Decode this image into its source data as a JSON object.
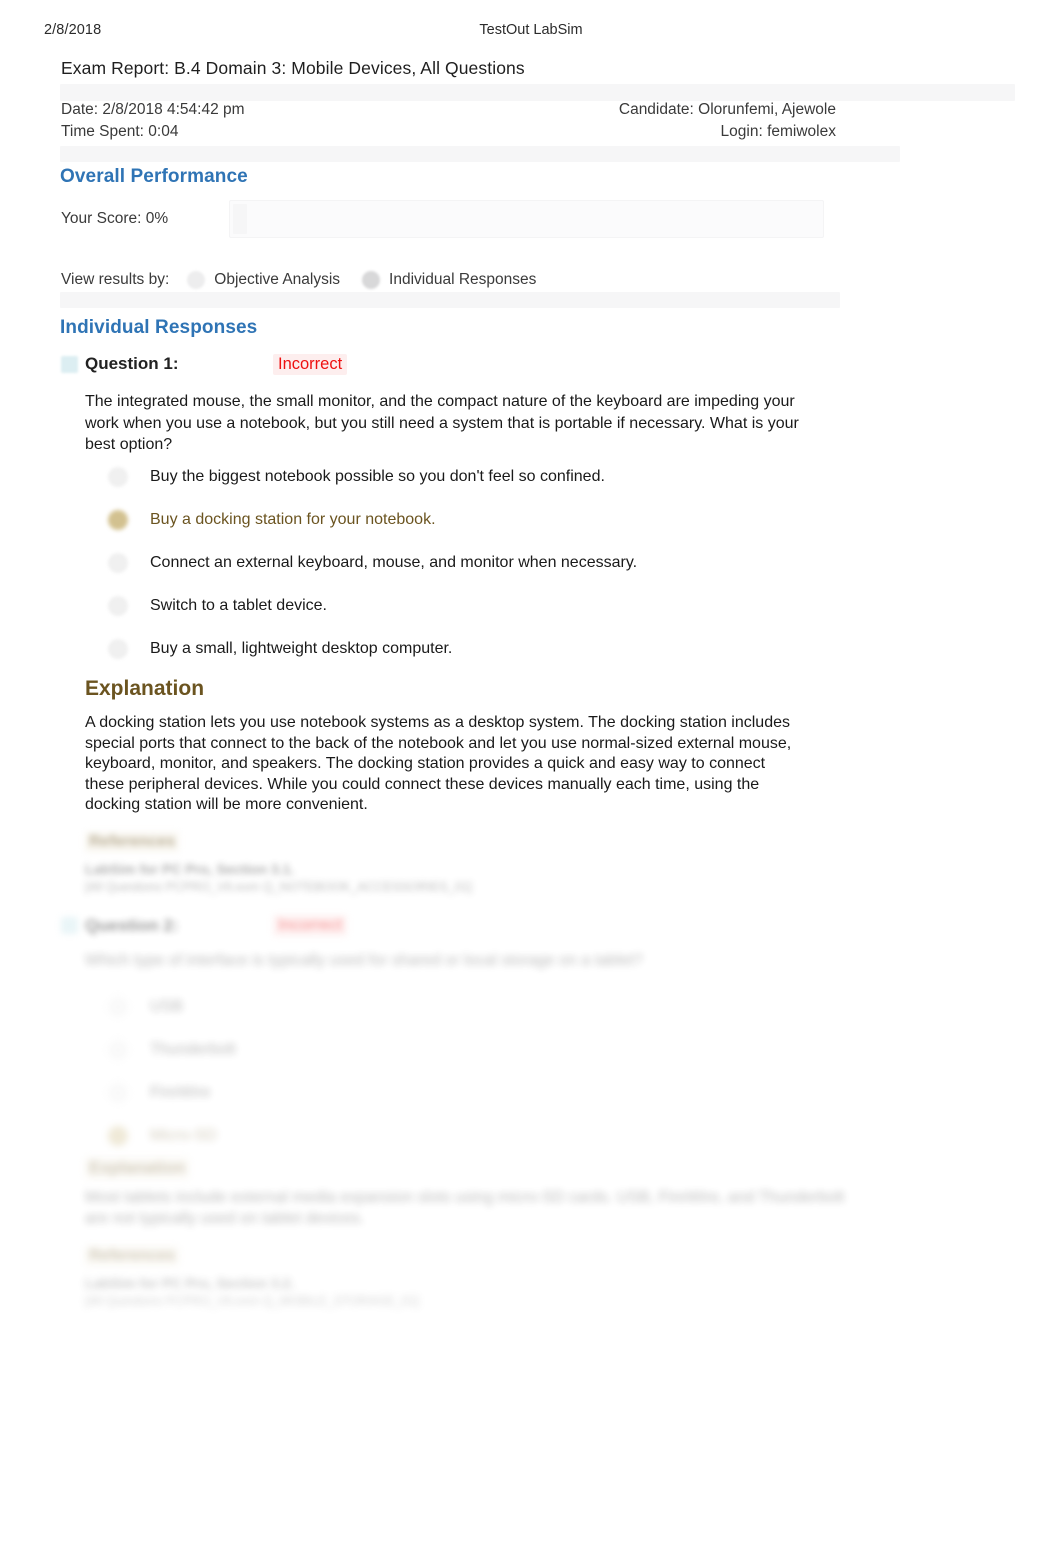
{
  "header": {
    "date": "2/8/2018",
    "app_title": "TestOut LabSim"
  },
  "report": {
    "title": "Exam Report: B.4 Domain 3: Mobile Devices, All Questions",
    "date_label": "Date: 2/8/2018 4:54:42 pm",
    "time_spent_label": "Time Spent: 0:04",
    "candidate_label": "Candidate: Olorunfemi, Ajewole",
    "login_label": "Login: femiwolex"
  },
  "overall": {
    "heading": "Overall Performance",
    "score_label": "Your Score: 0%",
    "score_percent": 0
  },
  "view_by": {
    "label": "View results by:",
    "options": [
      {
        "label": "Objective Analysis",
        "selected": false
      },
      {
        "label": "Individual Responses",
        "selected": true
      }
    ]
  },
  "individual_responses": {
    "heading": "Individual Responses",
    "questions": [
      {
        "label": "Question 1:",
        "status": "Incorrect",
        "text": "The integrated mouse, the small monitor, and the compact nature of the keyboard are impeding your work when you use a notebook, but you still need a system that is portable if necessary. What is your best option?",
        "options": [
          {
            "text": "Buy the biggest notebook possible so you don't feel so confined.",
            "correct": false
          },
          {
            "text": "Buy a docking station for your notebook.",
            "correct": true
          },
          {
            "text": "Connect an external keyboard, mouse, and monitor when necessary.",
            "correct": false
          },
          {
            "text": "Switch to a tablet device.",
            "correct": false
          },
          {
            "text": "Buy a small, lightweight desktop computer.",
            "correct": false
          }
        ],
        "explanation_heading": "Explanation",
        "explanation": "A docking station lets you use notebook systems as a desktop system. The docking station includes special ports that connect to the back of the notebook and let you use normal-sized external mouse, keyboard, monitor, and speakers. The docking station provides a quick and easy way to connect these peripheral devices. While you could connect these devices manually each time, using the docking station will be more convenient.",
        "references_heading": "References",
        "reference_lines": [
          "LabSim for PC Pro, Section 3.1.",
          "[All Questions PCPRO_V6.exm Q_NOTEBOOK_ACCESSORIES_01]"
        ]
      },
      {
        "label": "Question 2:",
        "status": "Incorrect",
        "text": "Which type of interface is typically used for shared or local storage on a tablet?",
        "options": [
          {
            "text": "USB",
            "correct": false
          },
          {
            "text": "Thunderbolt",
            "correct": false
          },
          {
            "text": "FireWire",
            "correct": false
          },
          {
            "text": "Micro-SD",
            "correct": true
          }
        ],
        "explanation_heading": "Explanation",
        "explanation": "Most tablets include external media expansion slots using micro-SD cards. USB, FireWire, and Thunderbolt are not typically used on tablet devices.",
        "references_heading": "References",
        "reference_lines": [
          "LabSim for PC Pro, Section 3.2.",
          "[All Questions PCPRO_V6.exm Q_MOBILE_STORAGE_01]"
        ]
      }
    ]
  },
  "icons": {
    "question_flag": "flag-icon",
    "radio_unselected": "radio-unselected-icon",
    "radio_selected": "radio-selected-icon",
    "correct_marker": "correct-answer-icon"
  },
  "colors": {
    "heading_blue": "#2f74b5",
    "explanation_brown": "#6b5420",
    "incorrect_red": "#ee1111",
    "correct_answer_text": "#6b5420",
    "page_background": "#ffffff"
  }
}
